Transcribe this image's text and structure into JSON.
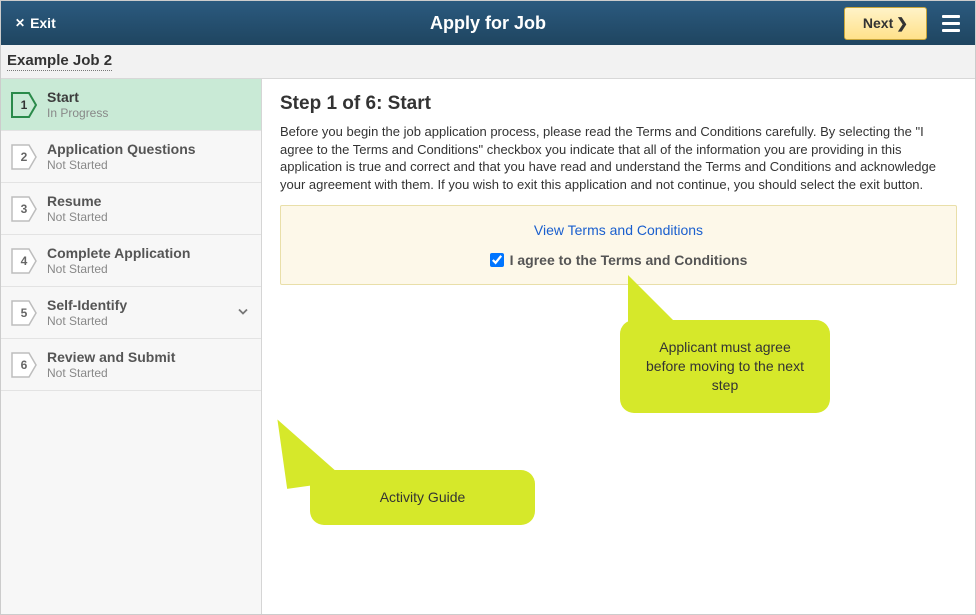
{
  "header": {
    "exit_label": "Exit",
    "title": "Apply for Job",
    "next_label": "Next"
  },
  "subheader": {
    "job_name": "Example Job 2"
  },
  "sidebar": {
    "steps": [
      {
        "num": "1",
        "name": "Start",
        "status": "In Progress",
        "active": true
      },
      {
        "num": "2",
        "name": "Application Questions",
        "status": "Not Started",
        "active": false
      },
      {
        "num": "3",
        "name": "Resume",
        "status": "Not Started",
        "active": false
      },
      {
        "num": "4",
        "name": "Complete Application",
        "status": "Not Started",
        "active": false
      },
      {
        "num": "5",
        "name": "Self-Identify",
        "status": "Not Started",
        "active": false,
        "expandable": true
      },
      {
        "num": "6",
        "name": "Review and Submit",
        "status": "Not Started",
        "active": false
      }
    ]
  },
  "content": {
    "heading": "Step 1 of 6: Start",
    "paragraph": "Before you begin the job application process, please read the Terms and Conditions carefully. By selecting the \"I agree to the Terms and Conditions\" checkbox you indicate that all of the information you are providing in this application is true and correct and that you have read and understand the Terms and Conditions and acknowledge your agreement with them. If you wish to exit this application and not continue, you should select the exit button.",
    "terms_link": "View Terms and Conditions",
    "agree_label": "I agree to the Terms and Conditions",
    "agree_checked": true
  },
  "callouts": {
    "c1": "Applicant must agree before moving to the next step",
    "c2": "Activity Guide"
  }
}
